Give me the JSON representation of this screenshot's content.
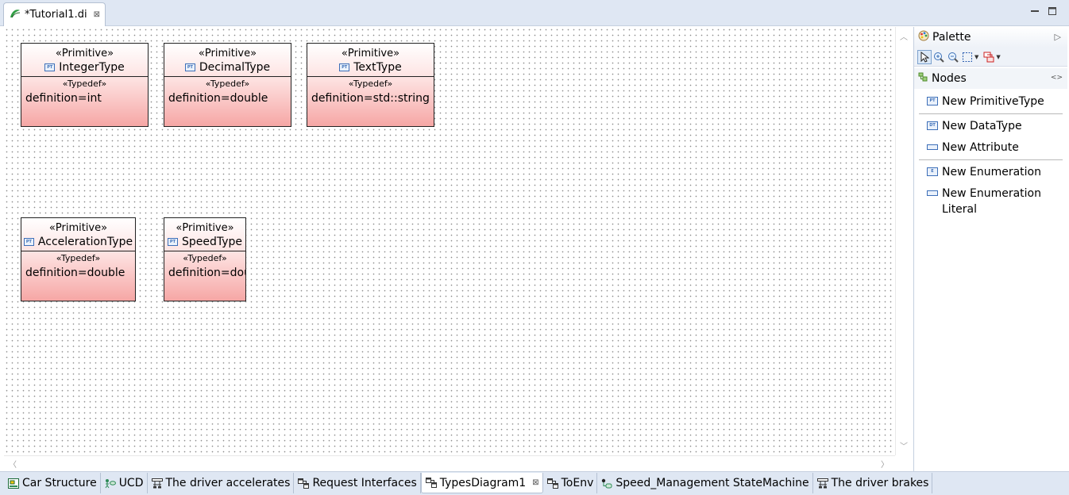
{
  "editor": {
    "tab_title": "*Tutorial1.di",
    "close_glyph": "⊠"
  },
  "diagram": {
    "nodes": [
      {
        "stereotype": "«Primitive»",
        "name": "IntegerType",
        "typedef": "«Typedef»",
        "attribute": "definition=int"
      },
      {
        "stereotype": "«Primitive»",
        "name": "DecimalType",
        "typedef": "«Typedef»",
        "attribute": "definition=double"
      },
      {
        "stereotype": "«Primitive»",
        "name": "TextType",
        "typedef": "«Typedef»",
        "attribute": "definition=std::string"
      },
      {
        "stereotype": "«Primitive»",
        "name": "AccelerationType",
        "typedef": "«Typedef»",
        "attribute": "definition=double"
      },
      {
        "stereotype": "«Primitive»",
        "name": "SpeedType",
        "typedef": "«Typedef»",
        "attribute": "definition=double"
      }
    ]
  },
  "palette": {
    "title": "Palette",
    "drawer": "Nodes",
    "items": [
      {
        "label": "New PrimitiveType",
        "icon": "primitive-type-icon"
      },
      {
        "label": "New DataType",
        "icon": "datatype-icon"
      },
      {
        "label": "New Attribute",
        "icon": "attribute-icon"
      },
      {
        "label": "New Enumeration",
        "icon": "enumeration-icon"
      },
      {
        "label": "New Enumeration Literal",
        "icon": "enumeration-literal-icon"
      }
    ]
  },
  "bottom_tabs": [
    {
      "label": "Car Structure",
      "icon": "composite-diagram-icon",
      "color": "#2e8b57"
    },
    {
      "label": "UCD",
      "icon": "usecase-diagram-icon",
      "color": "#2e8b57"
    },
    {
      "label": "The driver accelerates",
      "icon": "activity-diagram-icon",
      "color": "#333333"
    },
    {
      "label": "Request Interfaces",
      "icon": "class-diagram-icon",
      "color": "#333333"
    },
    {
      "label": "TypesDiagram1",
      "icon": "class-diagram-icon",
      "color": "#333333",
      "active": true
    },
    {
      "label": "ToEnv",
      "icon": "class-diagram-icon",
      "color": "#333333"
    },
    {
      "label": "Speed_Management StateMachine",
      "icon": "statemachine-diagram-icon",
      "color": "#2e8b57"
    },
    {
      "label": "The driver brakes",
      "icon": "activity-diagram-icon",
      "color": "#333333"
    }
  ]
}
